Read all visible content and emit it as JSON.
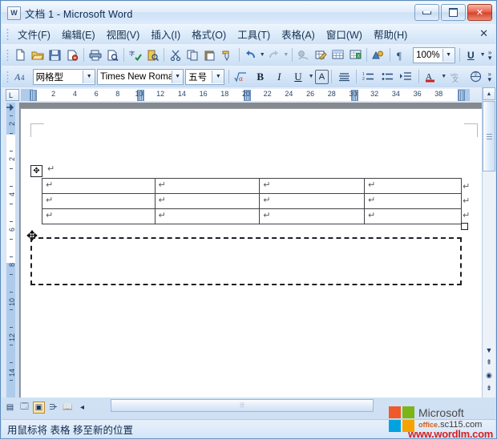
{
  "window": {
    "title": "文档 1 - Microsoft Word",
    "app_icon": "word-document-icon",
    "caption": {
      "minimize": "minimize-icon",
      "maximize": "maximize-icon",
      "close": "✕"
    }
  },
  "menubar": {
    "items": [
      {
        "label": "文件(F)",
        "name": "menu-file"
      },
      {
        "label": "编辑(E)",
        "name": "menu-edit"
      },
      {
        "label": "视图(V)",
        "name": "menu-view"
      },
      {
        "label": "插入(I)",
        "name": "menu-insert"
      },
      {
        "label": "格式(O)",
        "name": "menu-format"
      },
      {
        "label": "工具(T)",
        "name": "menu-tools"
      },
      {
        "label": "表格(A)",
        "name": "menu-table"
      },
      {
        "label": "窗口(W)",
        "name": "menu-window"
      },
      {
        "label": "帮助(H)",
        "name": "menu-help"
      }
    ],
    "close_document": "✕"
  },
  "toolbar_standard": {
    "buttons": [
      {
        "icon": "new-document-icon",
        "glyph": "🗋"
      },
      {
        "icon": "open-folder-icon",
        "glyph": "📂"
      },
      {
        "icon": "save-icon",
        "glyph": "💾"
      },
      {
        "icon": "permission-icon",
        "glyph": "🗈"
      },
      {
        "sep": true
      },
      {
        "icon": "print-icon",
        "glyph": "🖶"
      },
      {
        "icon": "print-preview-icon",
        "glyph": "🔍"
      },
      {
        "sep": true
      },
      {
        "icon": "spelling-check-icon",
        "glyph": "ABC"
      },
      {
        "icon": "research-icon",
        "glyph": "📖"
      },
      {
        "sep": true
      },
      {
        "icon": "cut-scissors-icon",
        "glyph": "✂"
      },
      {
        "icon": "copy-icon",
        "glyph": "🗐"
      },
      {
        "icon": "paste-icon",
        "glyph": "📋"
      },
      {
        "icon": "format-painter-icon",
        "glyph": "🖌"
      },
      {
        "sep": true
      },
      {
        "icon": "undo-icon",
        "glyph": "↰"
      },
      {
        "icon": "redo-icon",
        "glyph": "↱"
      },
      {
        "sep": true
      },
      {
        "icon": "insert-hyperlink-icon",
        "glyph": "🔗"
      },
      {
        "icon": "tables-and-borders-icon",
        "glyph": "🖉"
      },
      {
        "icon": "insert-table-icon",
        "glyph": "▦"
      },
      {
        "icon": "insert-excel-worksheet-icon",
        "glyph": "▤"
      },
      {
        "sep": true
      },
      {
        "icon": "drawing-icon",
        "glyph": "🖎"
      },
      {
        "sep": true
      },
      {
        "icon": "show-formatting-marks-icon",
        "glyph": "¶"
      }
    ],
    "zoom_value": "100%",
    "underline_label": "U"
  },
  "toolbar_formatting": {
    "style_icon": "styles-and-formatting-icon",
    "style_value": "网格型",
    "font_value": "Times New Roma",
    "size_value": "五号",
    "buttons": [
      {
        "icon": "math-formula-icon",
        "glyph": "√α"
      },
      {
        "icon": "bold-icon",
        "glyph": "B"
      },
      {
        "icon": "italic-icon",
        "glyph": "I"
      },
      {
        "icon": "underline-icon",
        "glyph": "U"
      },
      {
        "icon": "character-border-icon",
        "glyph": "A"
      },
      {
        "sep": true
      },
      {
        "icon": "align-distribute-icon",
        "glyph": "≡"
      },
      {
        "sep": true
      },
      {
        "icon": "numbered-list-icon",
        "glyph": "⒈≡"
      },
      {
        "icon": "bulleted-list-icon",
        "glyph": "•≡"
      },
      {
        "icon": "increase-indent-icon",
        "glyph": "⇥≡"
      },
      {
        "sep": true
      },
      {
        "icon": "font-color-icon",
        "glyph": "A"
      },
      {
        "icon": "phonetic-guide-icon",
        "glyph": "文"
      },
      {
        "icon": "enclose-characters-icon",
        "glyph": "⊕"
      }
    ]
  },
  "ruler": {
    "corner_tab_label": "L",
    "horizontal_numbers": [
      2,
      4,
      6,
      8,
      10,
      12,
      14,
      16,
      18,
      20,
      22,
      24,
      26,
      28,
      30,
      32,
      34,
      36,
      38
    ],
    "vertical_numbers": [
      2,
      2,
      4,
      6,
      8,
      10,
      12,
      14
    ]
  },
  "document": {
    "table": {
      "rows": 3,
      "columns": 4,
      "cell_mark": "↵",
      "move_handle_icon": "table-move-handle-icon",
      "resize_handle_icon": "table-resize-handle-icon"
    },
    "paragraph_mark": "↵",
    "drop_target": {
      "name": "table-drop-preview",
      "style": "dashed-rectangle"
    },
    "cursor": {
      "name": "move-cursor",
      "glyph": "✥"
    }
  },
  "scrollbars": {
    "vertical": {
      "up_arrow": "▲",
      "down_arrow": "▼",
      "previous_page": "⇞",
      "select_browse_object": "◉",
      "next_page": "⇟"
    },
    "horizontal": {
      "left_arrow": "◂",
      "thumb_grip": "⦙⦙⦙"
    }
  },
  "view_buttons": [
    {
      "name": "view-normal",
      "glyph": "▤",
      "active": false
    },
    {
      "name": "view-web-layout",
      "glyph": "🗔",
      "active": false
    },
    {
      "name": "view-print-layout",
      "glyph": "▣",
      "active": true
    },
    {
      "name": "view-outline",
      "glyph": "⋺",
      "active": false
    },
    {
      "name": "view-reading-layout",
      "glyph": "📖",
      "active": false
    }
  ],
  "statusbar": {
    "text": "用鼠标将 表格 移至新的位置"
  },
  "branding": {
    "microsoft": "Microsoft",
    "office_prefix": "office",
    "office_domain": ".sc115.com",
    "watermark": "www.wordlm.com",
    "logo_colors": [
      "#f05a28",
      "#7cb518",
      "#00a3e0",
      "#f5a300"
    ]
  },
  "colors": {
    "title_text": "#0e2a4f",
    "frame": "#5b8bbd",
    "watermark_red": "#d81f1f",
    "accent_orange": "#d35b12"
  }
}
